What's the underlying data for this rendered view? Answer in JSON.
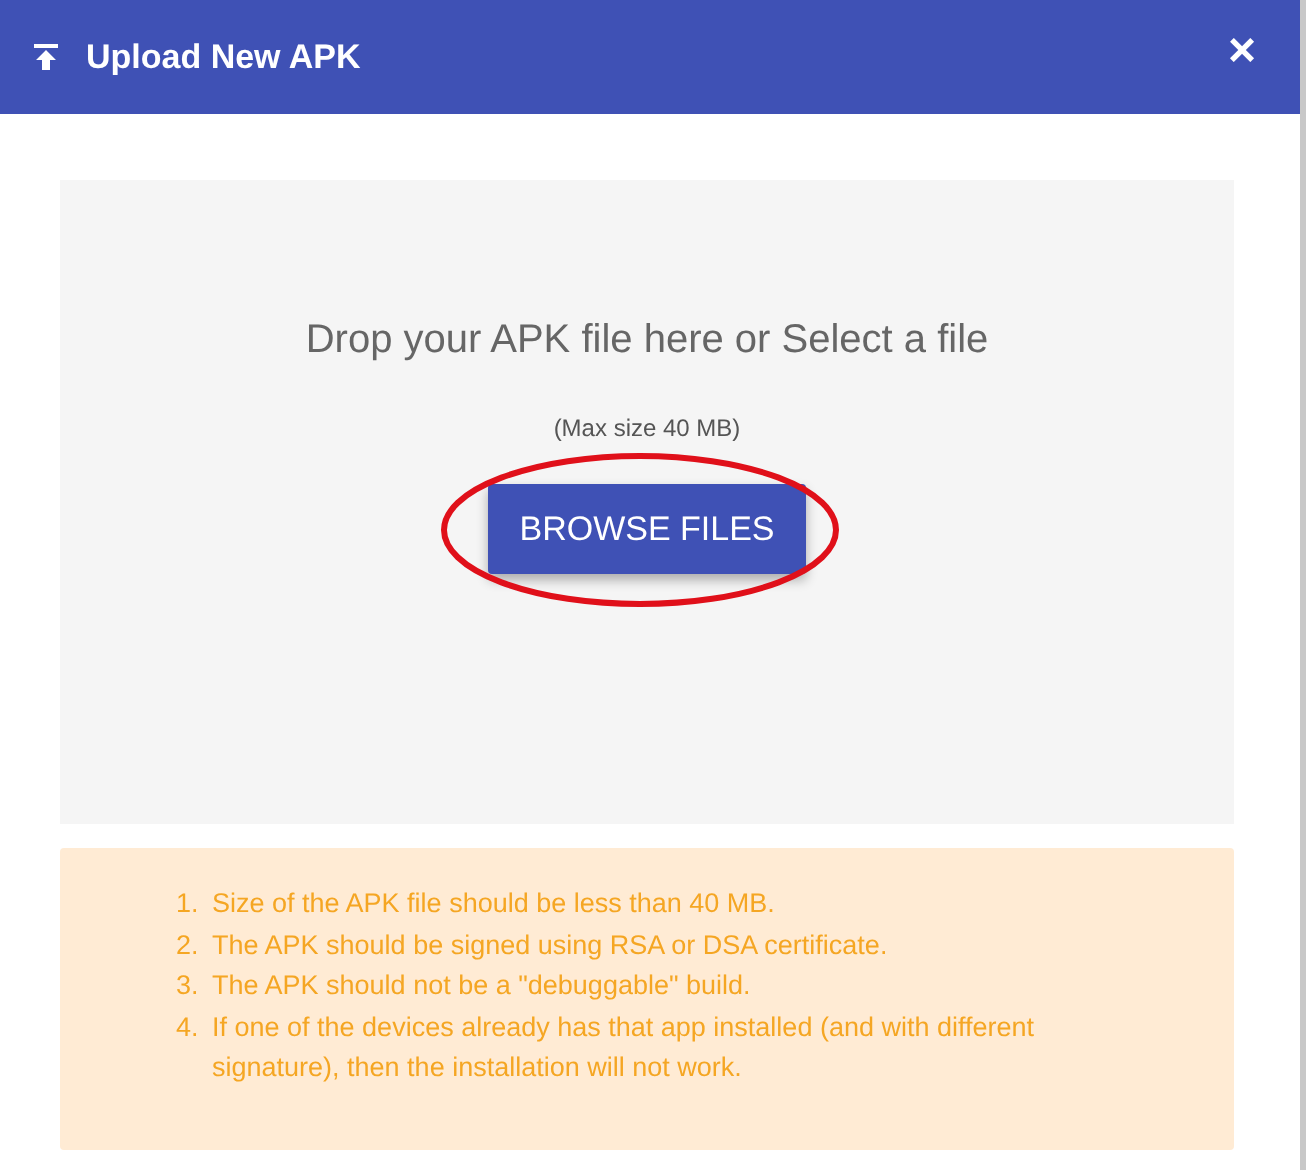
{
  "dialog": {
    "title": "Upload New APK",
    "close": "×"
  },
  "dropzone": {
    "prompt": "Drop your APK file here or Select a file",
    "hint": "(Max size 40 MB)",
    "button": "BROWSE FILES"
  },
  "notes": [
    {
      "number": "1.",
      "text": "Size of the APK file should be less than 40 MB."
    },
    {
      "number": "2.",
      "text": "The APK should be signed using RSA or DSA certificate."
    },
    {
      "number": "3.",
      "text": "The APK should not be a \"debuggable\" build."
    },
    {
      "number": "4.",
      "text": "If one of the devices already has that app installed (and with different signature), then the installation will not work."
    }
  ]
}
